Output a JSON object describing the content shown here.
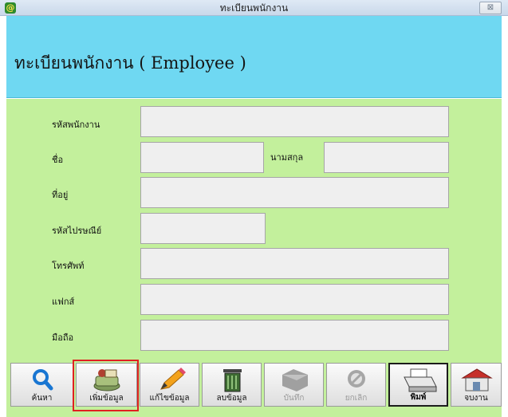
{
  "window": {
    "title": "ทะเบียนพนักงาน",
    "app_icon": "@",
    "close_glyph": "⊠"
  },
  "header": {
    "title": "ทะเบียนพนักงาน ( Employee )"
  },
  "form": {
    "employee_code": {
      "label": "รหัสพนักงาน",
      "value": ""
    },
    "first_name": {
      "label": "ชื่อ",
      "value": ""
    },
    "last_name": {
      "label": "นามสกุล",
      "value": ""
    },
    "address": {
      "label": "ที่อยู่",
      "value": ""
    },
    "postal_code": {
      "label": "รหัสไปรษณีย์",
      "value": ""
    },
    "phone": {
      "label": "โทรศัพท์",
      "value": ""
    },
    "fax": {
      "label": "แฟกส์",
      "value": ""
    },
    "mobile": {
      "label": "มือถือ",
      "value": ""
    }
  },
  "toolbar": {
    "search": {
      "label": "ค้นหา",
      "icon": "magnifier-icon"
    },
    "add": {
      "label": "เพิ่มข้อมูล",
      "icon": "add-record-icon"
    },
    "edit": {
      "label": "แก้ไขข้อมูล",
      "icon": "pencil-icon"
    },
    "delete": {
      "label": "ลบข้อมูล",
      "icon": "trash-icon"
    },
    "save": {
      "label": "บันทึก",
      "icon": "save-icon",
      "disabled": true
    },
    "cancel": {
      "label": "ยกเลิก",
      "icon": "cancel-icon",
      "disabled": true
    },
    "print": {
      "label": "พิมพ์",
      "icon": "printer-icon",
      "selected": true
    },
    "exit": {
      "label": "จบงาน",
      "icon": "house-icon"
    }
  },
  "colors": {
    "header_band": "#6fd8f2",
    "form_background": "#c3f09c",
    "field_background": "#efefef",
    "highlight": "#e02020"
  }
}
